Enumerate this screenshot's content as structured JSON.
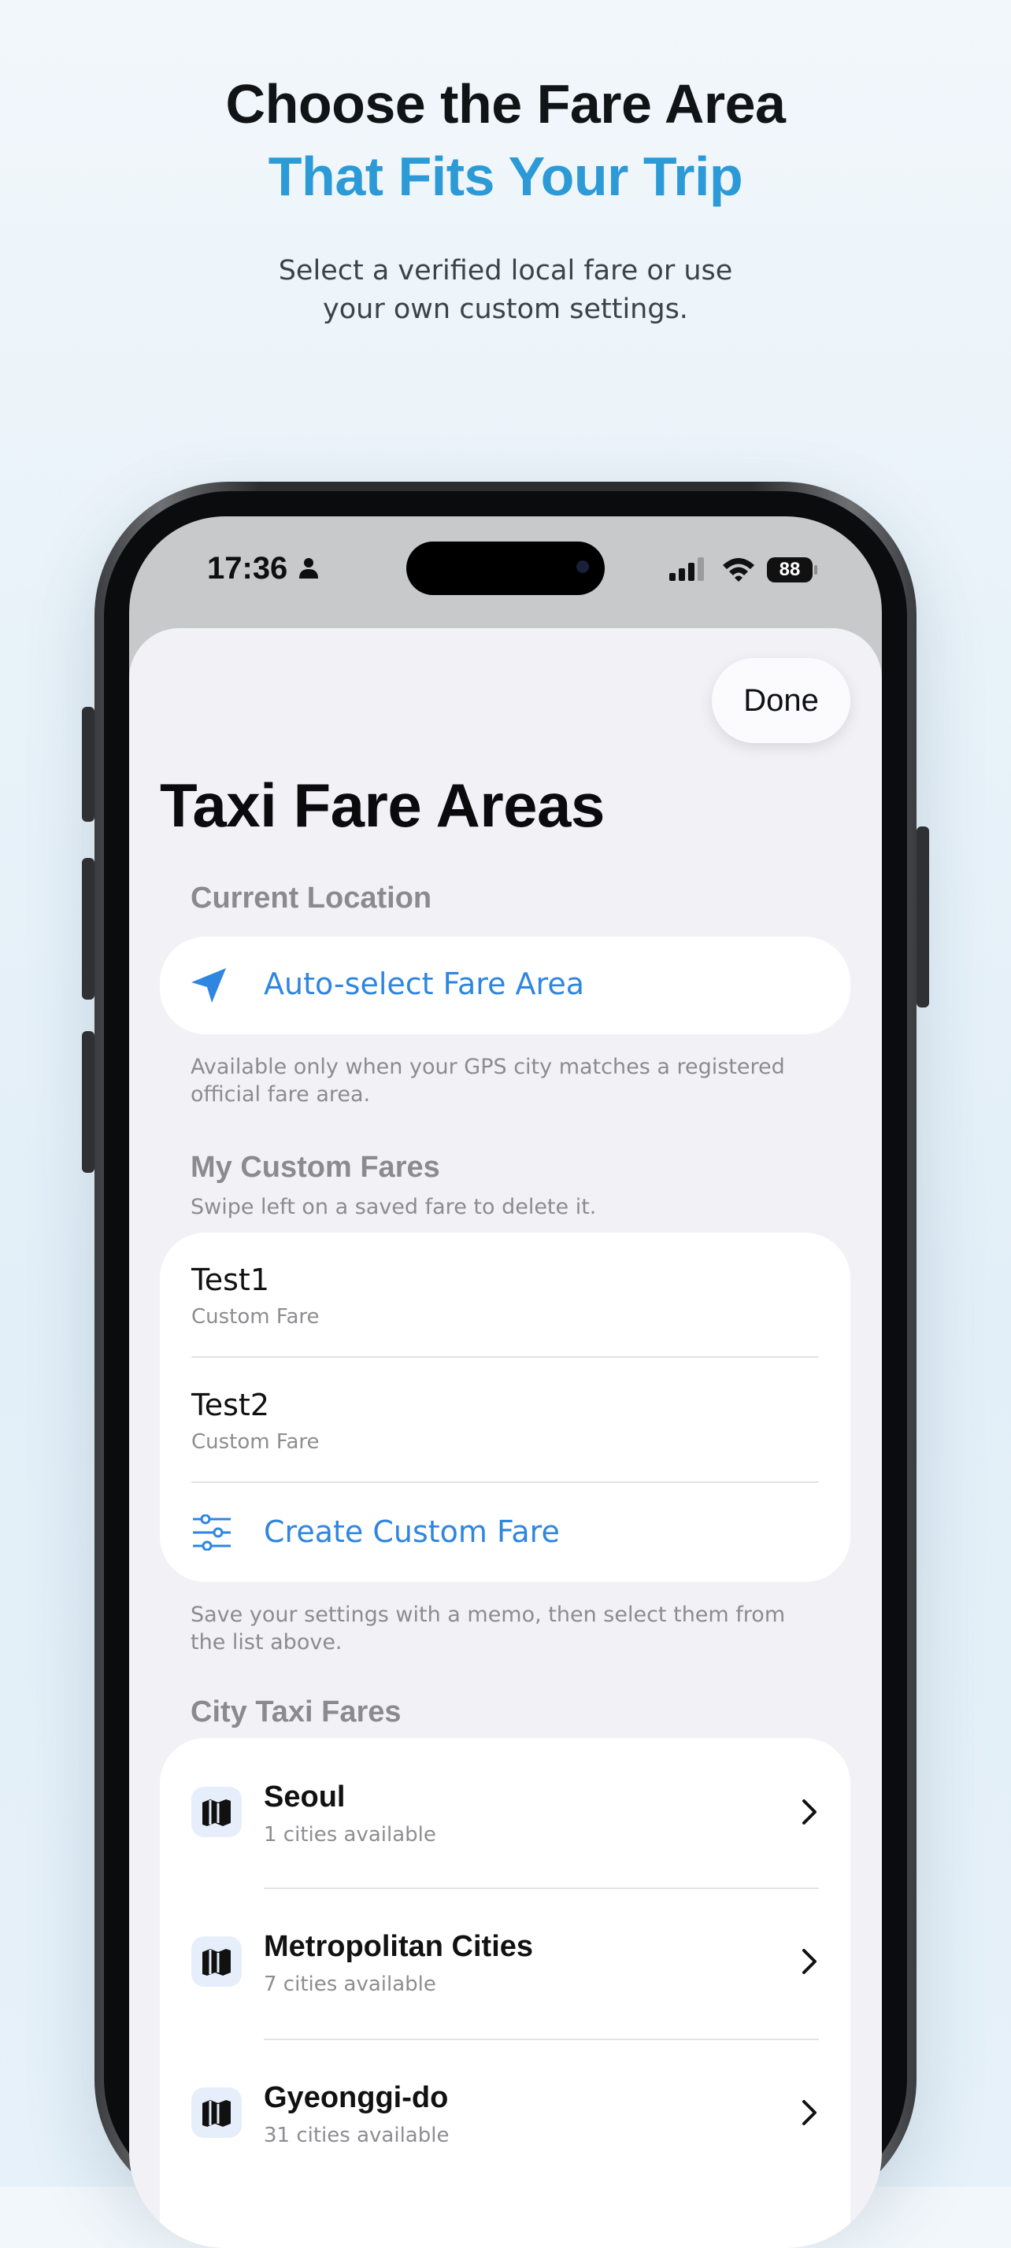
{
  "headline": {
    "line1": "Choose the Fare Area",
    "line2": "That Fits Your Trip",
    "subtitle_line1": "Select a verified local fare or use",
    "subtitle_line2": "your own custom settings."
  },
  "status_bar": {
    "time": "17:36",
    "battery": "88"
  },
  "sheet": {
    "done_label": "Done",
    "title": "Taxi Fare Areas",
    "current_location": {
      "header": "Current Location",
      "auto_select_label": "Auto-select Fare Area",
      "note_line1": "Available only when your GPS city matches a registered",
      "note_line2": "official fare area."
    },
    "custom_fares": {
      "header": "My Custom Fares",
      "hint": "Swipe left on a saved fare to delete it.",
      "items": [
        {
          "name": "Test1",
          "type": "Custom Fare"
        },
        {
          "name": "Test2",
          "type": "Custom Fare"
        }
      ],
      "create_label": "Create Custom Fare",
      "note_line1": "Save your settings with a memo, then select them from",
      "note_line2": "the list above."
    },
    "city_fares": {
      "header": "City Taxi Fares",
      "items": [
        {
          "name": "Seoul",
          "count": "1 cities available"
        },
        {
          "name": "Metropolitan Cities",
          "count": "7 cities available"
        },
        {
          "name": "Gyeonggi-do",
          "count": "31 cities available"
        }
      ]
    }
  },
  "colors": {
    "accent": "#2f86e0",
    "headline_blue": "#2b9ad6"
  }
}
